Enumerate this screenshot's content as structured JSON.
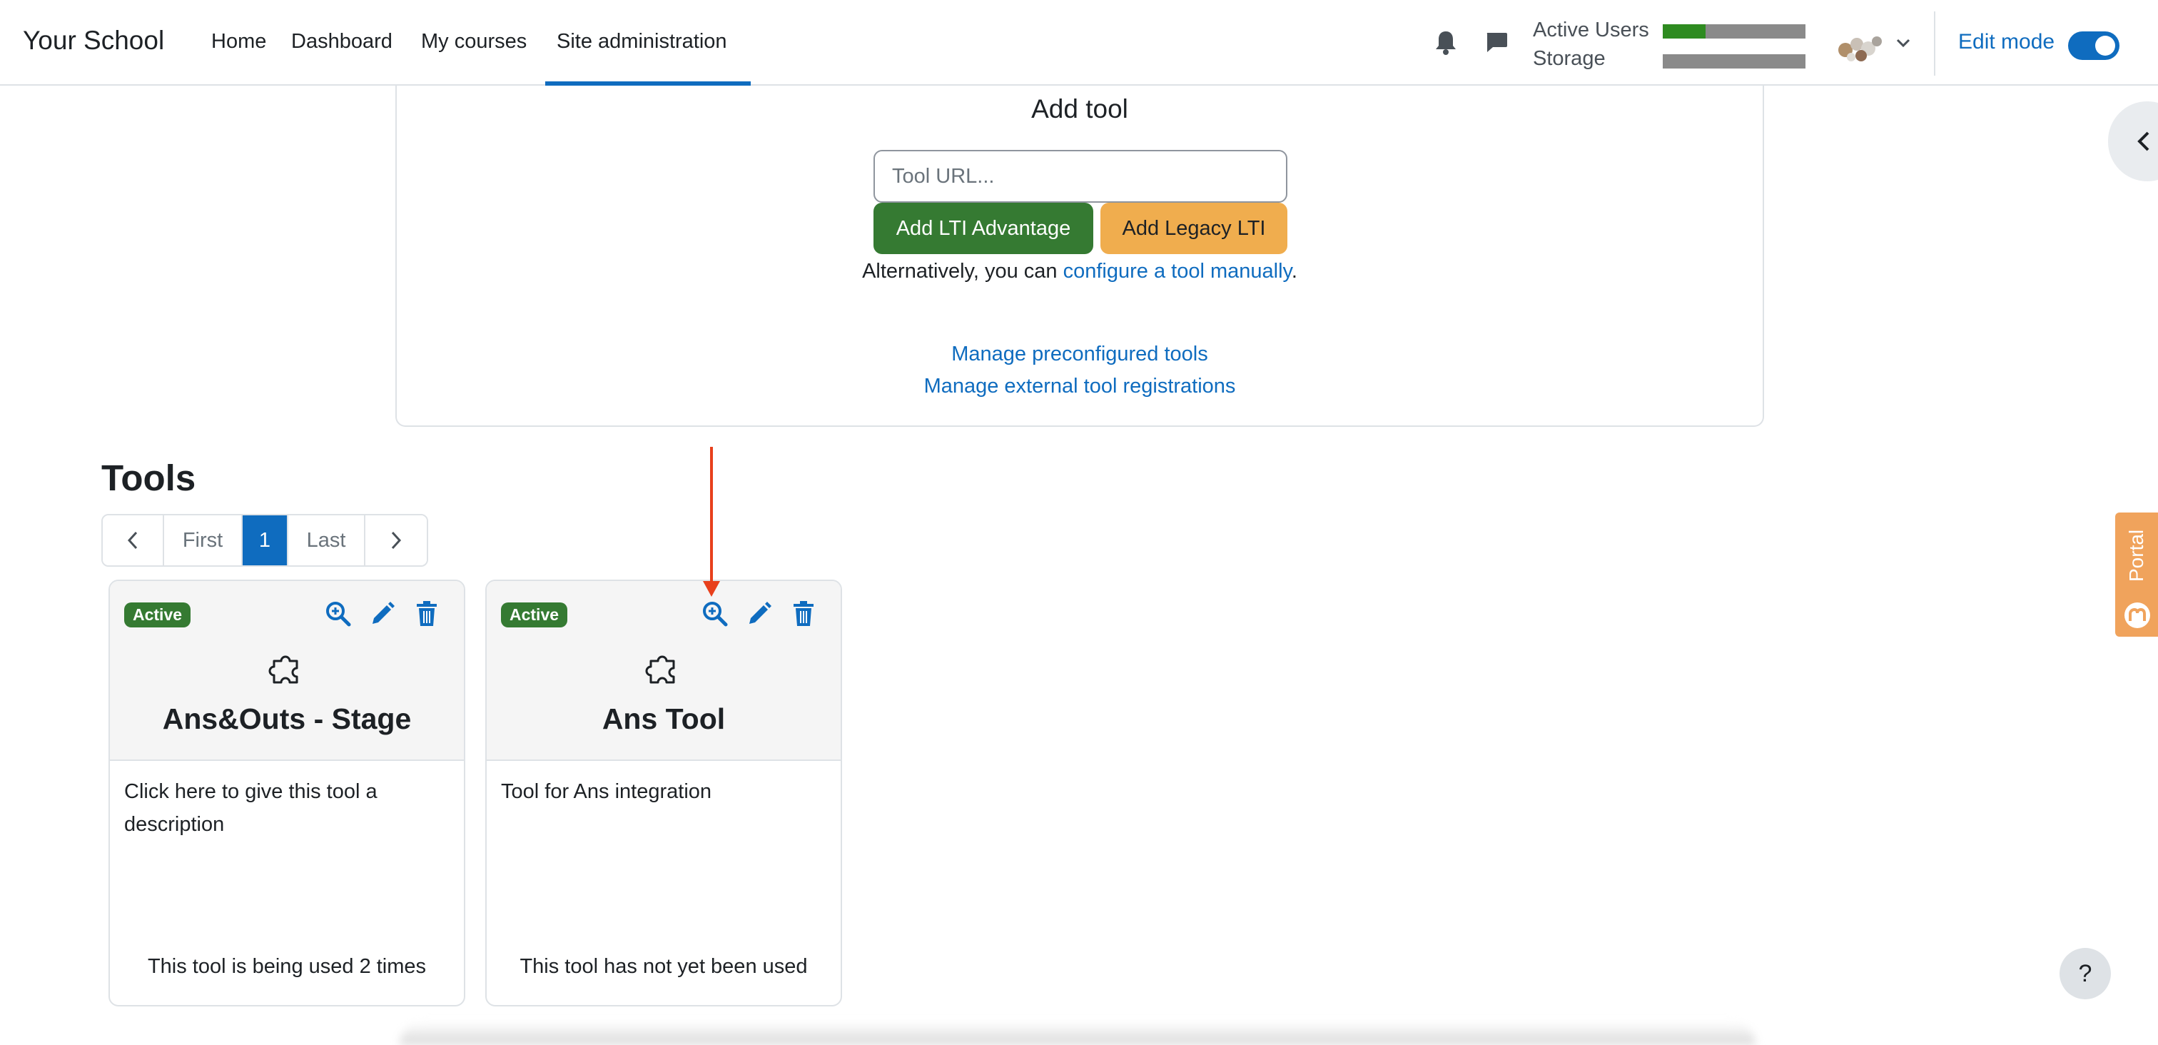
{
  "navbar": {
    "brand": "Your School",
    "items": [
      {
        "label": "Home"
      },
      {
        "label": "Dashboard"
      },
      {
        "label": "My courses"
      },
      {
        "label": "Site administration",
        "active": true
      }
    ],
    "meters": [
      {
        "label": "Active Users",
        "fill_fraction": 0.3
      },
      {
        "label": "Storage",
        "fill_fraction": 0.0
      }
    ],
    "edit_mode_label": "Edit mode",
    "edit_mode_on": true,
    "icons": [
      "bell-icon",
      "chat-icon",
      "chevron-down-icon"
    ]
  },
  "drawer": {
    "icon": "chevron-left-icon"
  },
  "portal": {
    "label": "Portal",
    "icon": "moodle-portal-icon"
  },
  "add_tool": {
    "title": "Add tool",
    "url_placeholder": "Tool URL...",
    "advantage_button": "Add LTI Advantage",
    "legacy_button": "Add Legacy LTI",
    "alt_prefix": "Alternatively, you can ",
    "alt_link": "configure a tool manually",
    "alt_suffix": ".",
    "manage_preconfigured": "Manage preconfigured tools",
    "manage_registrations": "Manage external tool registrations"
  },
  "tools": {
    "heading": "Tools",
    "pagination": {
      "first": "First",
      "current": "1",
      "last": "Last"
    },
    "cards": [
      {
        "status": "Active",
        "title": "Ans&Outs - Stage",
        "description": "Click here to give this tool a description",
        "usage": "This tool is being used 2 times"
      },
      {
        "status": "Active",
        "title": "Ans Tool",
        "description": "Tool for Ans integration",
        "usage": "This tool has not yet been used"
      }
    ]
  },
  "help": {
    "label": "?"
  },
  "colors": {
    "primary": "#0f6cbf",
    "success": "#357a32",
    "warning": "#f0ad4e",
    "annotation": "#e8401c"
  }
}
